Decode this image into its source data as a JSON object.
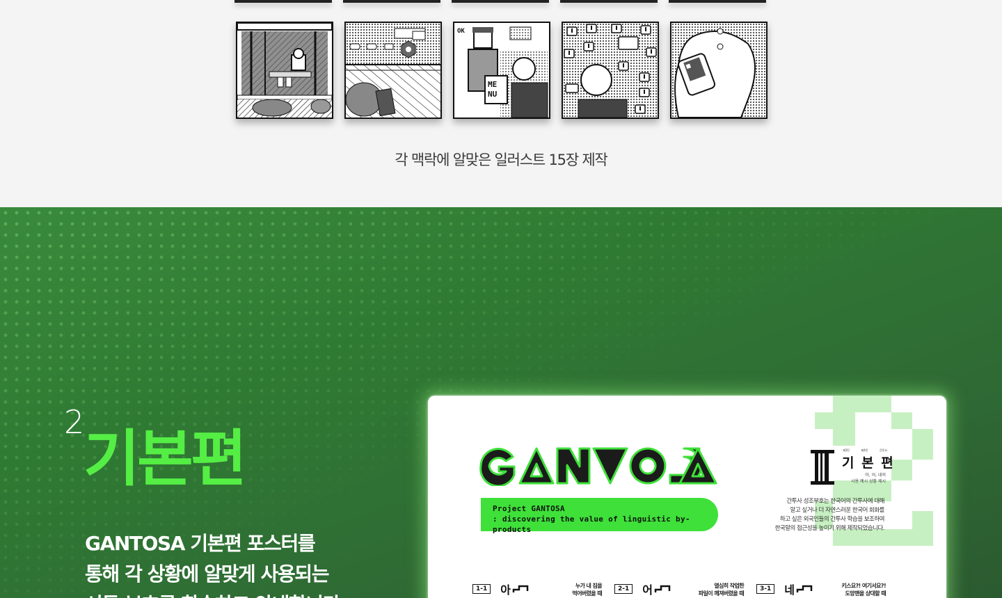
{
  "gallery": {
    "illustrations": [
      {
        "label": "subway-platform-scene"
      },
      {
        "label": "street-top-view-scene"
      },
      {
        "label": "menu-ordering-scene"
      },
      {
        "label": "confused-person-scene"
      },
      {
        "label": "phone-call-scene"
      }
    ],
    "ok_text": "OK",
    "menu_text_1": "ME",
    "menu_text_2": "NU",
    "caption": "각 맥락에 알맞은 일러스트 15장 제작"
  },
  "section": {
    "number": "2",
    "title": "기본편",
    "description_line1": "GANTOSA 기본편 포스터를",
    "description_line2": "통해 각 상황에 알맞게 사용되는",
    "description_line3": "서툰 부호를 학습하고 안내합니다."
  },
  "poster": {
    "logo_text": "GANTOSA",
    "banner_line1": "Project GANTOSA",
    "banner_line2": ": discovering the value of linguistic by-products",
    "tags": [
      "제3탄",
      "제4탄",
      "간투사"
    ],
    "title": "기 본 편",
    "subtitle_line1": "아, 어, 네의",
    "subtitle_line2": "사용 예시 상황 제시",
    "body_line1": "간투사 성조부호는 한국어의 간투사에 대해",
    "body_line2": "알고 싶거나 더 자연스러운 한국어 회화를",
    "body_line3": "하고 싶은 외국인들의 간투사 학습을 보조하여",
    "body_line4": "한국말의 접근성을 높이기 위해 제작되었습니다.",
    "rows": [
      {
        "tag": "1-1",
        "word": "아",
        "note_line1": "누가 내 짐을",
        "note_line2": "먹어버렸을 때"
      },
      {
        "tag": "2-1",
        "word": "어",
        "note_line1": "열심히 작업한",
        "note_line2": "파일이 깨져버렸을 때"
      },
      {
        "tag": "3-1",
        "word": "네",
        "note_line1": "키스요?! 여기서요?!",
        "note_line2": "도망맨을 상대할 때"
      }
    ]
  },
  "colors": {
    "accent_green": "#3ee039",
    "title_green": "#55ee45",
    "section_bg": "#2f7a33"
  }
}
